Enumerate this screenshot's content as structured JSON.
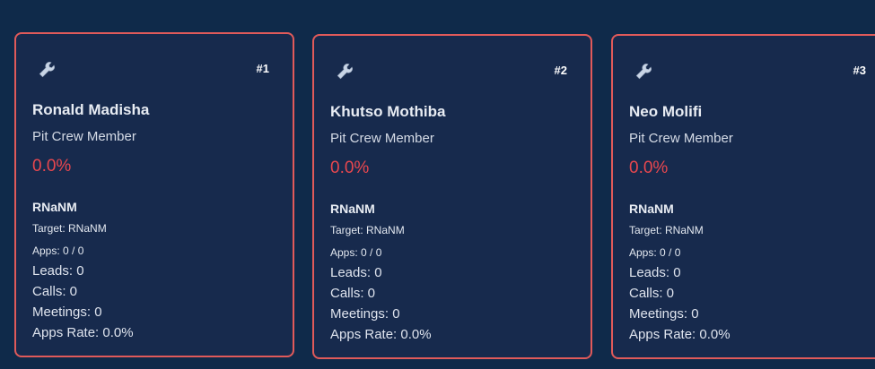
{
  "cards": [
    {
      "rank": "#1",
      "name": "Ronald Madisha",
      "role": "Pit Crew Member",
      "percent": "0.0%",
      "main": "RNaNM",
      "target": "Target: RNaNM",
      "apps": "Apps: 0 / 0",
      "leads": "Leads: 0",
      "calls": "Calls: 0",
      "meetings": "Meetings: 0",
      "apps_rate": "Apps Rate: 0.0%"
    },
    {
      "rank": "#2",
      "name": "Khutso Mothiba",
      "role": "Pit Crew Member",
      "percent": "0.0%",
      "main": "RNaNM",
      "target": "Target: RNaNM",
      "apps": "Apps: 0 / 0",
      "leads": "Leads: 0",
      "calls": "Calls: 0",
      "meetings": "Meetings: 0",
      "apps_rate": "Apps Rate: 0.0%"
    },
    {
      "rank": "#3",
      "name": "Neo Molifi",
      "role": "Pit Crew Member",
      "percent": "0.0%",
      "main": "RNaNM",
      "target": "Target: RNaNM",
      "apps": "Apps: 0 / 0",
      "leads": "Leads: 0",
      "calls": "Calls: 0",
      "meetings": "Meetings: 0",
      "apps_rate": "Apps Rate: 0.0%"
    }
  ],
  "icons": {
    "card_icon": "wrench-icon"
  },
  "colors": {
    "background": "#0f2a4a",
    "card": "#172a4d",
    "border": "#e05a5a",
    "percent": "#e8474e"
  }
}
